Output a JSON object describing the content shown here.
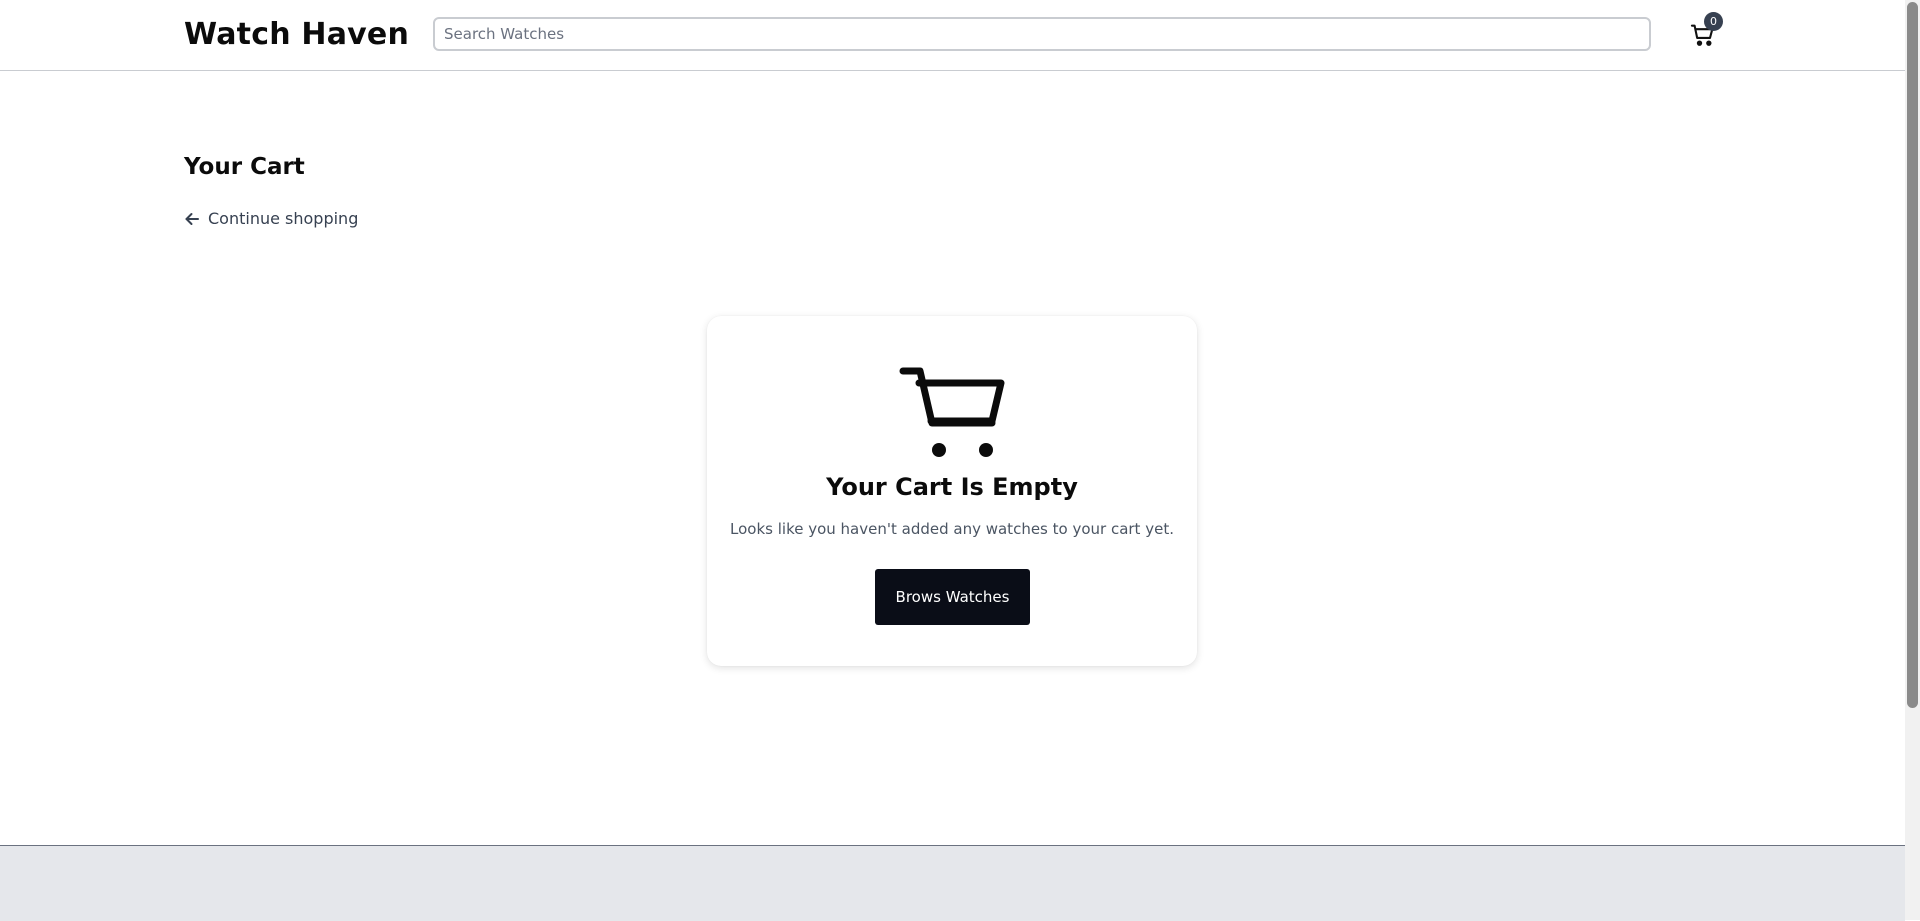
{
  "header": {
    "brand": "Watch Haven",
    "search_placeholder": "Search Watches",
    "search_value": "",
    "cart_icon": "cart-icon",
    "cart_count": "0"
  },
  "main": {
    "title": "Your Cart",
    "back_link": {
      "icon": "arrow-left-icon",
      "label": "Continue shopping"
    },
    "empty_state": {
      "icon": "cart-icon",
      "title": "Your Cart Is Empty",
      "message": "Looks like you haven't added any watches to your cart yet.",
      "button_label": "Brows Watches"
    }
  },
  "colors": {
    "primary_button": "#0a0d17",
    "badge": "#374151",
    "footer_bg": "#e5e7eb"
  }
}
